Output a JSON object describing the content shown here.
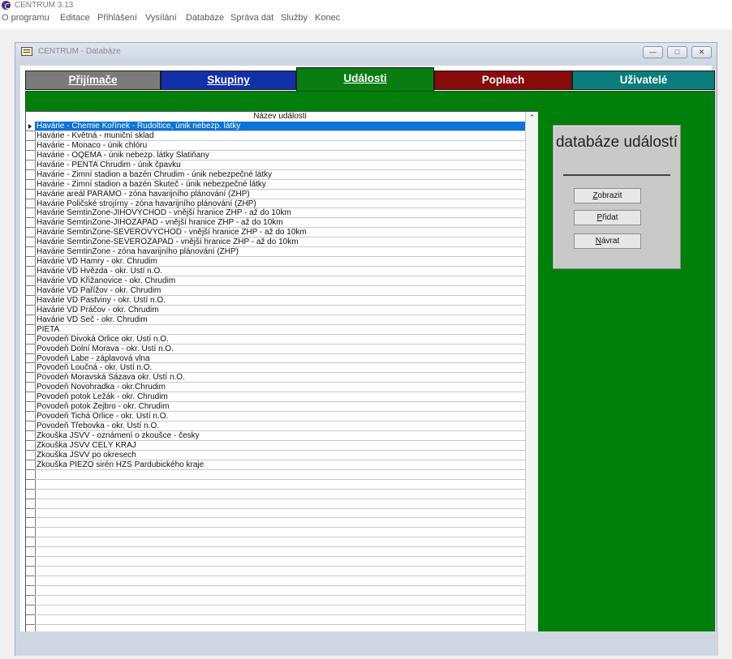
{
  "app": {
    "title": "CENTRUM 3.13"
  },
  "menu": [
    "O programu",
    "Editace",
    "Přihlášení",
    "Vysílání",
    "Databáze",
    "Správa dat",
    "Služby",
    "Konec"
  ],
  "window": {
    "title": "CENTRUM - Databáze"
  },
  "tabs": [
    {
      "label": "Přijímače",
      "bg": "#7b7b7b",
      "fg": "#ffffff",
      "active": false
    },
    {
      "label": "Skupiny",
      "bg": "#1230a8",
      "fg": "#ffffff",
      "active": false
    },
    {
      "label": "Události",
      "bg": "#0a7d12",
      "fg": "#ffffff",
      "active": true
    },
    {
      "label": "Poplach",
      "bg": "#8a0b0b",
      "fg": "#ffffff",
      "active": false
    },
    {
      "label": "Uživatelé",
      "bg": "#0b7d7d",
      "fg": "#ffffff",
      "active": false
    }
  ],
  "grid": {
    "header": "Název události",
    "rows": [
      "Havárie - Chemie Kořínek - Rudoltice, únik nebezp. látky",
      "Havárie - Květná - muniční sklad",
      "Havárie - Monaco - únik chlóru",
      "Havárie - OQEMA - únik nebezp. látky Slatiňany",
      "Havárie - PENTA Chrudim - únik čpavku",
      "Havárie - Zimní stadion a bazén Chrudim - únik nebezpečné látky",
      "Havárie - Zimní stadion a bazén Skuteč - únik nebezpečné látky",
      "Havárie areál PARAMO - zóna havarijního plánování (ZHP)",
      "Havárie Poličské strojírny - zóna havarijního plánování (ZHP)",
      "Havárie SemtinZone-JIHOVÝCHOD - vnější hranice ZHP - až do 10km",
      "Havárie SemtinZone-JIHOZÁPAD - vnější hranice ZHP - až do 10km",
      "Havárie SemtinZone-SEVEROVÝCHOD - vnější hranice ZHP - až do 10km",
      "Havárie SemtinZone-SEVEROZÁPAD - vnější hranice ZHP - až do 10km",
      "Havárie SemtinZone - zóna havarijního plánování (ZHP)",
      "Havárie VD Hamry - okr. Chrudim",
      "Havárie VD Hvězda - okr. Ústí n.O.",
      "Havárie VD Křižanovice - okr. Chrudim",
      "Havárie VD Pařížov - okr. Chrudim",
      "Havárie VD Pastviny - okr. Ústí n.O.",
      "Havárie VD Práčov - okr. Chrudim",
      "Havárie VD Seč - okr. Chrudim",
      "PIETA",
      "Povodeň Divoká Orlice okr. Ústí n.O.",
      "Povodeň Dolní Morava - okr. Ústí n.O.",
      "Povodeň Labe - záplavová vlna",
      "Povodeň Loučná - okr. Ústí n.O.",
      "Povodeň Moravská Sázava okr. Ústí n.O.",
      "Povodeň Novohradka - okr.Chrudim",
      "Povodeň potok Ležák - okr. Chrudim",
      "Povodeň potok Žejbro - okr. Chrudim",
      "Povodeň Tichá Orlice - okr. Ústí n.O.",
      "Povodeň Třebovka - okr. Ústí n.O.",
      "Zkouška JSVV - oznámení o zkoušce - česky",
      "Zkouška JSVV CELÝ KRAJ",
      "Zkouška JSVV po okresech",
      "Zkouška PIEZO sirén HZS Pardubického kraje"
    ],
    "selected_index": 0
  },
  "side": {
    "title": "databáze událostí",
    "buttons": [
      "Zobrazit",
      "Přidat",
      "Návrat"
    ]
  }
}
